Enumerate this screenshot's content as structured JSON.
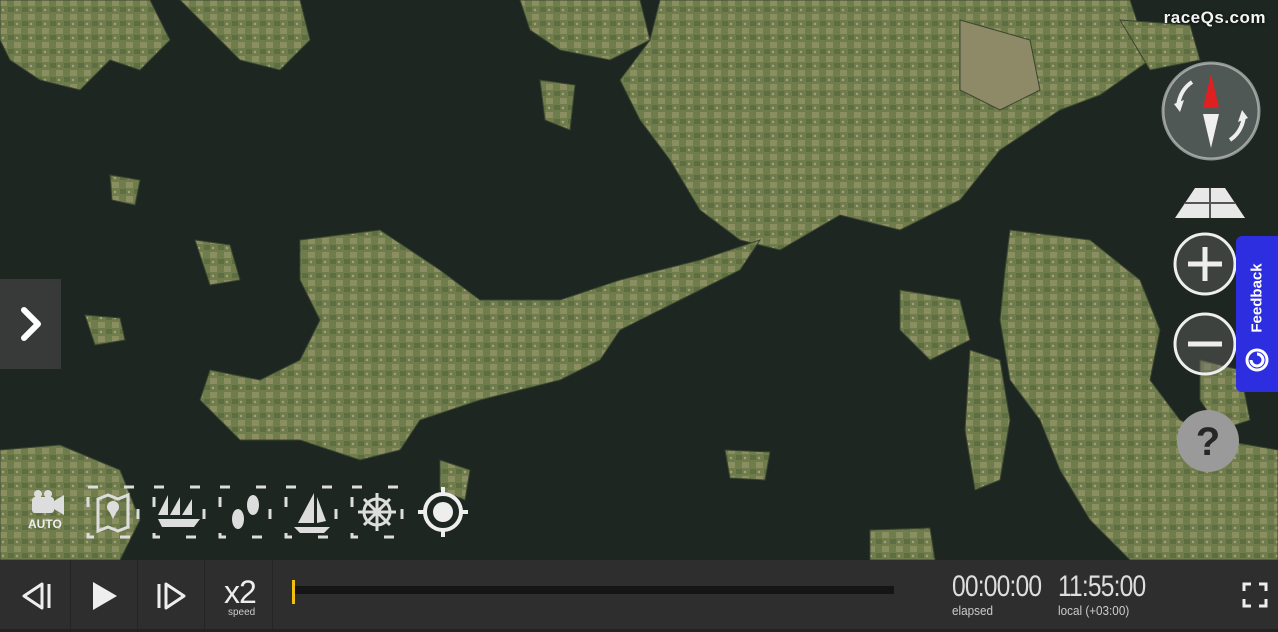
{
  "app": {
    "brand": "raceQs.com"
  },
  "map": {
    "imagery": "satellite"
  },
  "controls": {
    "side_toggle_icon": "chevron-right-icon",
    "compass_icon": "compass-icon",
    "view_icon": "perspective-view-icon",
    "zoom_in_icon": "plus-icon",
    "zoom_out_icon": "minus-icon",
    "help_label": "?",
    "feedback_label": "Feedback"
  },
  "tools": [
    {
      "name": "camera-auto",
      "icon": "video-camera-icon",
      "label": "AUTO"
    },
    {
      "name": "map-pin",
      "icon": "map-pin-icon"
    },
    {
      "name": "fleet",
      "icon": "fleet-icon"
    },
    {
      "name": "footprints",
      "icon": "footprints-icon"
    },
    {
      "name": "sail",
      "icon": "sailboat-icon"
    },
    {
      "name": "helm",
      "icon": "helm-icon"
    },
    {
      "name": "target",
      "icon": "crosshair-icon"
    }
  ],
  "playback": {
    "prev_icon": "step-back-icon",
    "play_icon": "play-icon",
    "next_icon": "step-forward-icon",
    "speed_value": "x2",
    "speed_label": "speed",
    "elapsed_time": "00:00:00",
    "elapsed_label": "elapsed",
    "local_time": "11:55:00",
    "local_label": "local (+03:00)",
    "progress_fraction": 0,
    "fullscreen_icon": "fullscreen-icon"
  },
  "colors": {
    "water": "#1d2620",
    "land": "#6e7c4c",
    "land_light": "#a0a57a",
    "feedback": "#2d2ee0",
    "playhead": "#f2c010"
  }
}
